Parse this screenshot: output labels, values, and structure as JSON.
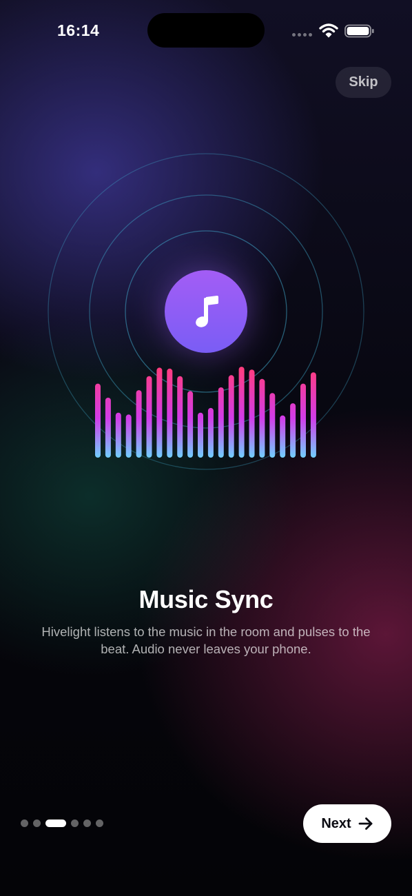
{
  "status_bar": {
    "time": "16:14",
    "signal_icon": "cellular-dots-icon",
    "wifi_icon": "wifi-icon",
    "battery_icon": "battery-icon"
  },
  "header": {
    "skip_label": "Skip"
  },
  "illustration": {
    "center_icon": "music-note-icon",
    "equalizer_levels": [
      0.79,
      0.64,
      0.48,
      0.46,
      0.72,
      0.87,
      0.96,
      0.95,
      0.87,
      0.71,
      0.48,
      0.53,
      0.75,
      0.88,
      0.97,
      0.94,
      0.84,
      0.69,
      0.45,
      0.58,
      0.79,
      0.91
    ],
    "colors": {
      "bar_top": "#ff3d7f",
      "bar_mid": "#d23ce8",
      "bar_bottom": "#6fd2ff",
      "ring": "#3fa6c8",
      "note_circle_top": "#a35df5",
      "note_circle_bottom": "#7a5df5"
    }
  },
  "content": {
    "title": "Music Sync",
    "description": "Hivelight listens to the music in the room and pulses to the beat. Audio never leaves your phone."
  },
  "pagination": {
    "total": 6,
    "active_index": 2
  },
  "footer": {
    "next_label": "Next",
    "next_icon": "arrow-right-icon"
  }
}
